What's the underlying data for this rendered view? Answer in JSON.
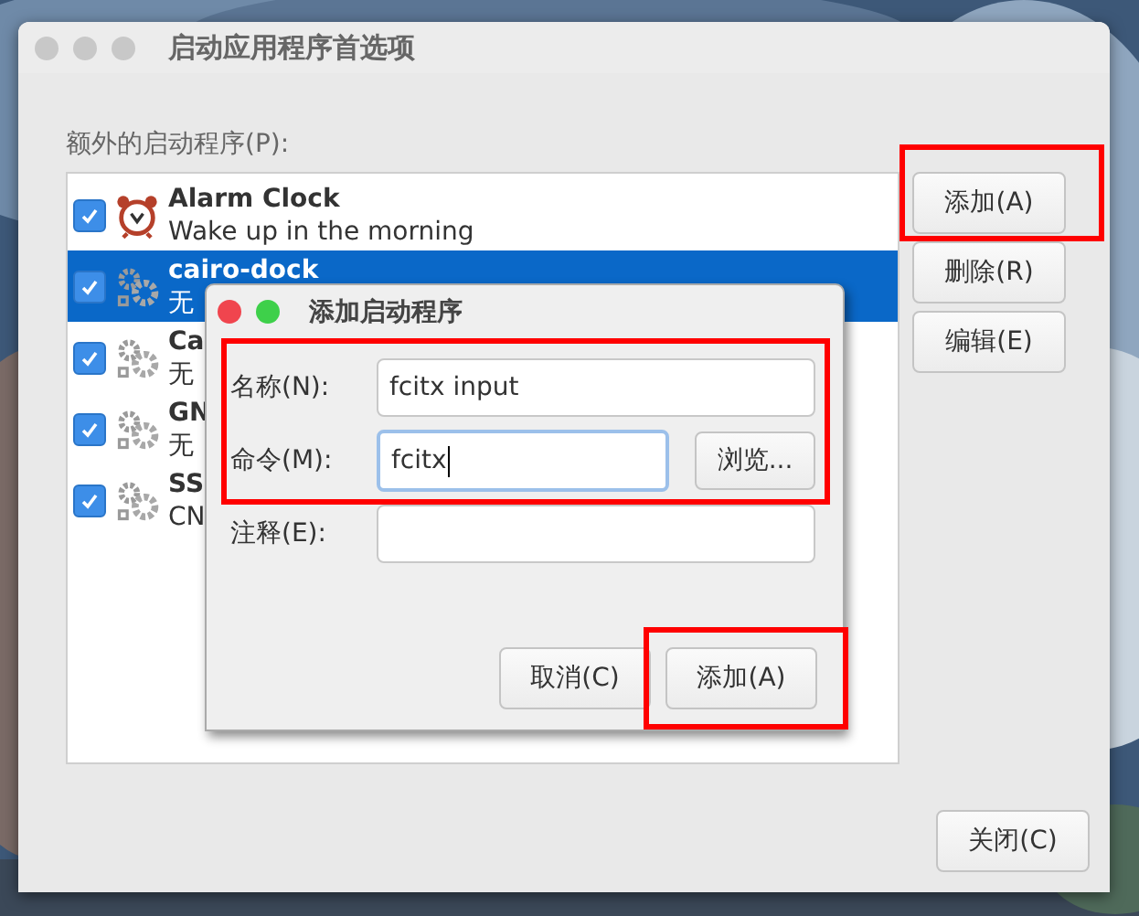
{
  "window": {
    "title": "启动应用程序首选项",
    "list_label": "额外的启动程序(P):",
    "programs": [
      {
        "name": "Alarm Clock",
        "description": "Wake up in the morning",
        "kind": "clock",
        "checked": true,
        "selected": false
      },
      {
        "name": "cairo-dock",
        "description": "无",
        "kind": "gears",
        "checked": true,
        "selected": true
      },
      {
        "name": "Ca",
        "description": "无",
        "kind": "gears",
        "checked": true,
        "selected": false
      },
      {
        "name": "GN",
        "description": "无",
        "kind": "gears",
        "checked": true,
        "selected": false
      },
      {
        "name": "SS",
        "description": "CN",
        "kind": "gears",
        "checked": true,
        "selected": false
      }
    ],
    "side_buttons": [
      {
        "label": "添加(A)",
        "highlighted": true
      },
      {
        "label": "删除(R)",
        "highlighted": false
      },
      {
        "label": "编辑(E)",
        "highlighted": false
      }
    ],
    "close_button": "关闭(C)"
  },
  "dialog": {
    "title": "添加启动程序",
    "fields_highlighted": true,
    "fields": [
      {
        "label": "名称(N):",
        "value": "fcitx input",
        "focused": false
      },
      {
        "label": "命令(M):",
        "value": "fcitx",
        "focused": true,
        "browse": "浏览..."
      },
      {
        "label": "注释(E):",
        "focused": false
      }
    ],
    "buttons": [
      {
        "label": "取消(C)",
        "highlighted": false
      },
      {
        "label": "添加(A)",
        "highlighted": true
      }
    ]
  }
}
